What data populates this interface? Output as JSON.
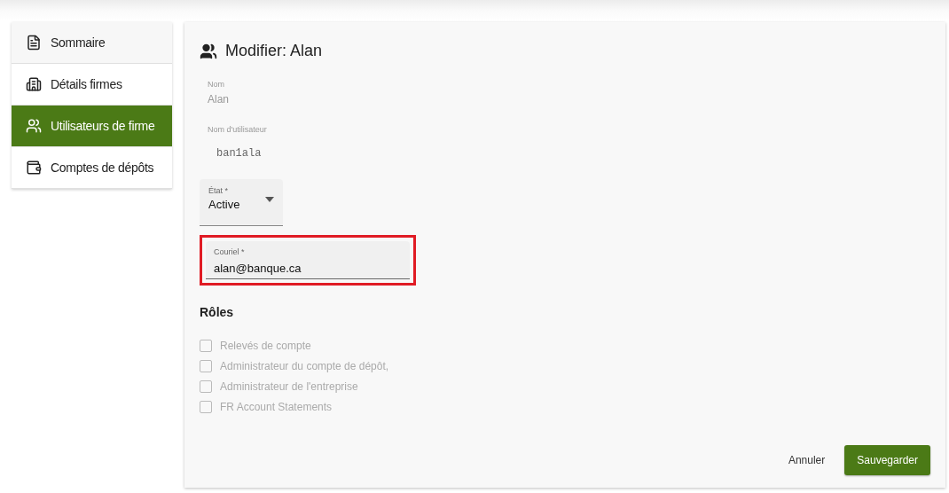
{
  "sidebar": {
    "items": [
      {
        "label": "Sommaire",
        "kind": "document",
        "selected": false
      },
      {
        "label": "Détails firmes",
        "kind": "building",
        "selected": false
      },
      {
        "label": "Utilisateurs de firme",
        "kind": "people",
        "selected": true
      },
      {
        "label": "Comptes de dépôts",
        "kind": "wallet",
        "selected": false
      }
    ]
  },
  "form": {
    "title": "Modifier: Alan",
    "fields": [
      {
        "kind": "readonly",
        "label": "Nom",
        "value": "Alan"
      },
      {
        "kind": "readonly-mono",
        "label": "Nom d'utilisateur",
        "value": "ban1ala"
      },
      {
        "kind": "select",
        "label": "État *",
        "value": "Active"
      },
      {
        "kind": "input",
        "label": "Couriel *",
        "value": "alan@banque.ca",
        "highlighted": true
      }
    ],
    "roles_title": "Rôles",
    "roles": [
      {
        "label": "Relevés de compte",
        "checked": false
      },
      {
        "label": "Administrateur du compte de dépôt,",
        "checked": false
      },
      {
        "label": "Administrateur de l'entreprise",
        "checked": false
      },
      {
        "label": "FR Account Statements",
        "checked": false
      }
    ],
    "buttons": [
      {
        "kind": "text",
        "label": "Annuler"
      },
      {
        "kind": "primary",
        "label": "Sauvegarder"
      }
    ]
  }
}
